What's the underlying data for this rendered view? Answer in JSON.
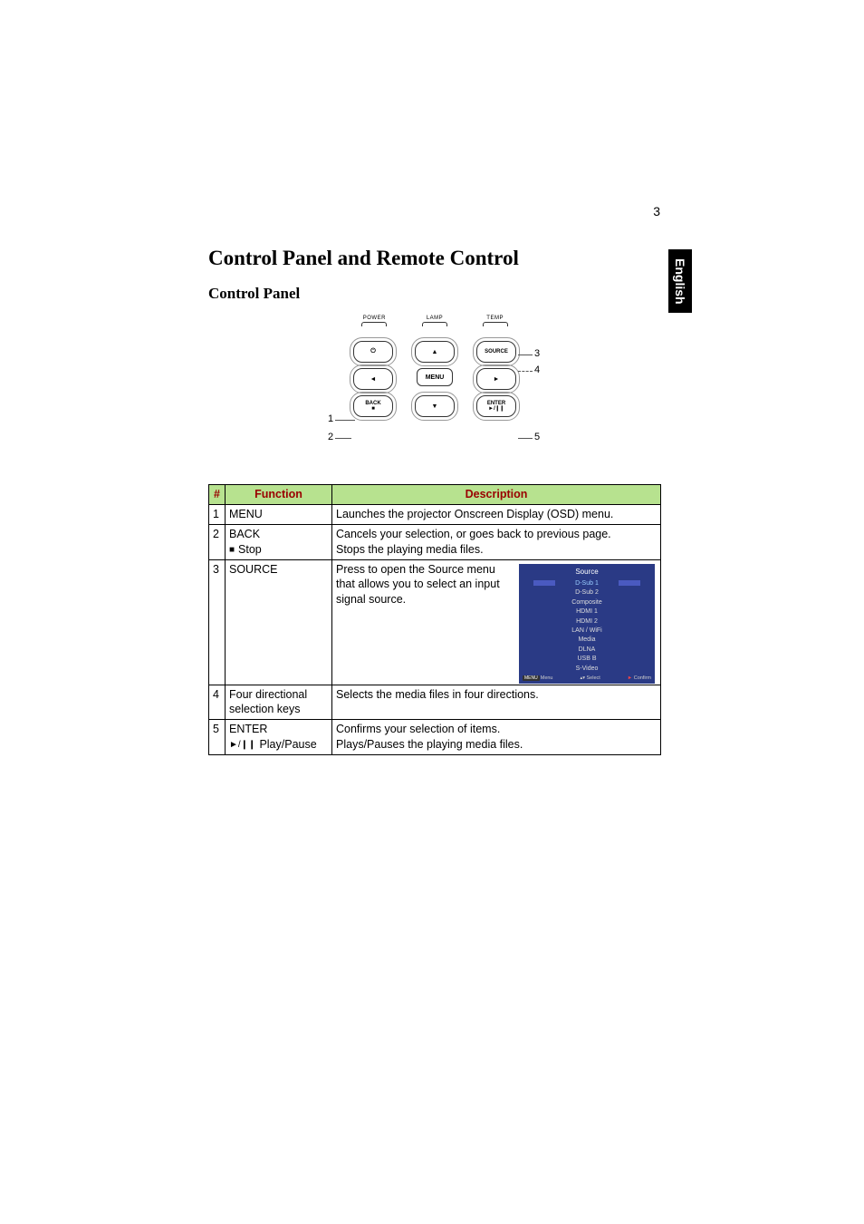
{
  "page": {
    "number": "3",
    "language_tab": "English"
  },
  "headings": {
    "section": "Control Panel and Remote Control",
    "subsection": "Control Panel"
  },
  "panel": {
    "leds": [
      "POWER",
      "LAMP",
      "TEMP"
    ],
    "buttons": {
      "power": "⏻",
      "up": "▲",
      "source": "SOURCE",
      "left": "◄",
      "menu": "MENU",
      "right": "►",
      "back": "BACK",
      "back_sub": "■",
      "down": "▼",
      "enter": "ENTER",
      "enter_sub": "►/❙❙"
    },
    "callouts": {
      "c1": "1",
      "c2": "2",
      "c3": "3",
      "c4": "4",
      "c5": "5"
    }
  },
  "table": {
    "headers": {
      "num": "#",
      "func": "Function",
      "desc": "Description"
    },
    "rows": [
      {
        "n": "1",
        "func": "MENU",
        "desc": "Launches the projector Onscreen Display (OSD) menu."
      },
      {
        "n": "2",
        "func_a": "BACK",
        "func_b_sym": "■",
        "func_b": "Stop",
        "desc_a": "Cancels your selection, or goes back to previous page.",
        "desc_b": "Stops the playing media files."
      },
      {
        "n": "3",
        "func": "SOURCE",
        "desc": "Press to open the Source menu that allows you to select an input signal source."
      },
      {
        "n": "4",
        "func": "Four directional selection keys",
        "desc": "Selects the media files in four directions."
      },
      {
        "n": "5",
        "func_a": "ENTER",
        "func_b_sym": "►/❙❙",
        "func_b": "Play/Pause",
        "desc_a": "Confirms your selection of items.",
        "desc_b": "Plays/Pauses the playing media files."
      }
    ]
  },
  "source_menu": {
    "title": "Source",
    "items": [
      "D-Sub 1",
      "D-Sub 2",
      "Composite",
      "HDMI 1",
      "HDMI 2",
      "LAN / WiFi",
      "Media",
      "DLNA",
      "USB B",
      "S-Video"
    ],
    "footer": {
      "menu_badge": "MENU",
      "menu": "Menu",
      "select": "Select",
      "select_glyph": "▴▾",
      "confirm": "Confirm",
      "confirm_glyph": "►"
    }
  }
}
